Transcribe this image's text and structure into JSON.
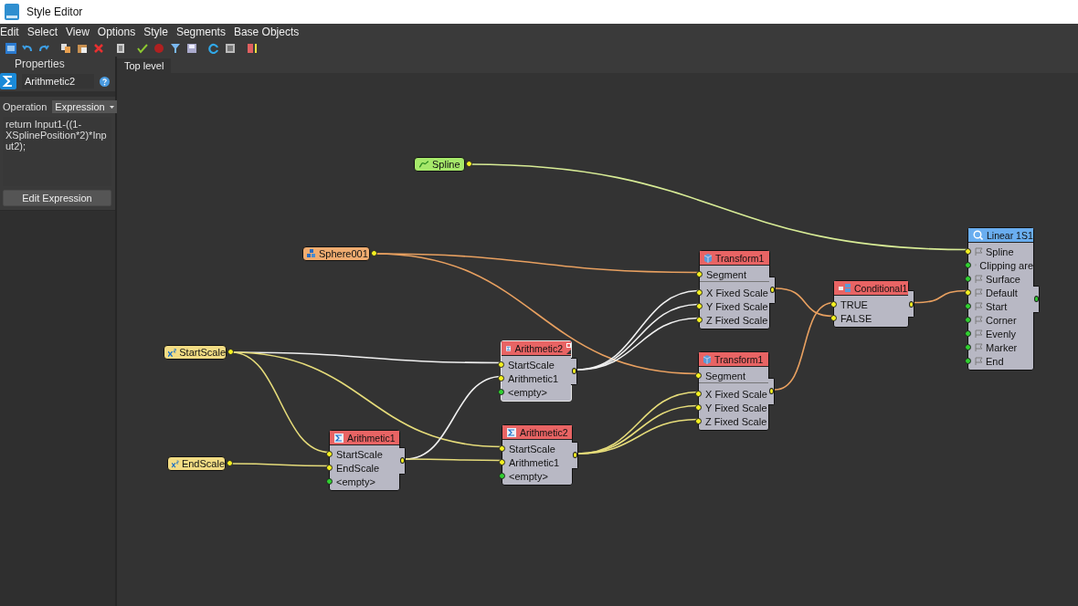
{
  "window": {
    "title": "Style Editor"
  },
  "menu": [
    "Edit",
    "Select",
    "View",
    "Options",
    "Style",
    "Segments",
    "Base Objects"
  ],
  "properties": {
    "title": "Properties",
    "node_name": "Arithmetic2",
    "operation_label": "Operation",
    "operation_value": "Expression",
    "expression": "return Input1-((1-XSplinePosition*2)*Input2);",
    "edit_button": "Edit Expression"
  },
  "canvas": {
    "tab": "Top level",
    "nodes": [
      {
        "kind": "spline",
        "title": "Spline",
        "color": "#a6e86a",
        "output_connected": true
      },
      {
        "kind": "object",
        "title": "Sphere001",
        "color": "#f0ac70",
        "output_connected": true
      },
      {
        "kind": "variable",
        "title": "StartScale",
        "color": "#f2dc84",
        "output_connected": true
      },
      {
        "kind": "variable",
        "title": "EndScale",
        "color": "#f2dc84",
        "output_connected": true
      },
      {
        "kind": "arithmetic",
        "title": "Arithmetic1",
        "color": "#e86464",
        "selected": false,
        "output_connected": true,
        "ports": [
          {
            "label": "StartScale",
            "connected": true
          },
          {
            "label": "EndScale",
            "connected": true
          },
          {
            "label": "<empty>",
            "connected": false
          }
        ]
      },
      {
        "kind": "arithmetic",
        "title": "Arithmetic2",
        "color": "#e86464",
        "selected": true,
        "output_connected": true,
        "ports": [
          {
            "label": "StartScale",
            "connected": true
          },
          {
            "label": "Arithmetic1",
            "connected": true
          },
          {
            "label": "<empty>",
            "connected": false
          }
        ]
      },
      {
        "kind": "arithmetic",
        "title": "Arithmetic2",
        "color": "#e86464",
        "selected": false,
        "output_connected": true,
        "ports": [
          {
            "label": "StartScale",
            "connected": true
          },
          {
            "label": "Arithmetic1",
            "connected": true
          },
          {
            "label": "<empty>",
            "connected": false
          }
        ]
      },
      {
        "kind": "transform",
        "title": "Transform1",
        "color": "#e86464",
        "selected": false,
        "output_connected": true,
        "ports": [
          {
            "label": "Segment",
            "connected": true
          },
          {
            "label": "X Fixed Scale",
            "connected": true
          },
          {
            "label": "Y Fixed Scale",
            "connected": true
          },
          {
            "label": "Z Fixed Scale",
            "connected": true
          }
        ]
      },
      {
        "kind": "transform",
        "title": "Transform1",
        "color": "#e86464",
        "selected": false,
        "output_connected": true,
        "ports": [
          {
            "label": "Segment",
            "connected": true
          },
          {
            "label": "X Fixed Scale",
            "connected": true
          },
          {
            "label": "Y Fixed Scale",
            "connected": true
          },
          {
            "label": "Z Fixed Scale",
            "connected": true
          }
        ]
      },
      {
        "kind": "conditional",
        "title": "Conditional1",
        "color": "#e86464",
        "selected": false,
        "output_connected": true,
        "ports": [
          {
            "label": "TRUE",
            "connected": true
          },
          {
            "label": "FALSE",
            "connected": true
          }
        ]
      },
      {
        "kind": "style",
        "title": "Linear 1S1",
        "color": "#6aaef0",
        "selected": false,
        "output_connected": false,
        "ports": [
          {
            "label": "Spline",
            "connected": true
          },
          {
            "label": "Clipping are",
            "connected": false
          },
          {
            "label": "Surface",
            "connected": false
          },
          {
            "label": "Default",
            "connected": true
          },
          {
            "label": "Start",
            "connected": false
          },
          {
            "label": "Corner",
            "connected": false
          },
          {
            "label": "Evenly",
            "connected": false
          },
          {
            "label": "Marker",
            "connected": false
          },
          {
            "label": "End",
            "connected": false
          }
        ]
      }
    ]
  }
}
